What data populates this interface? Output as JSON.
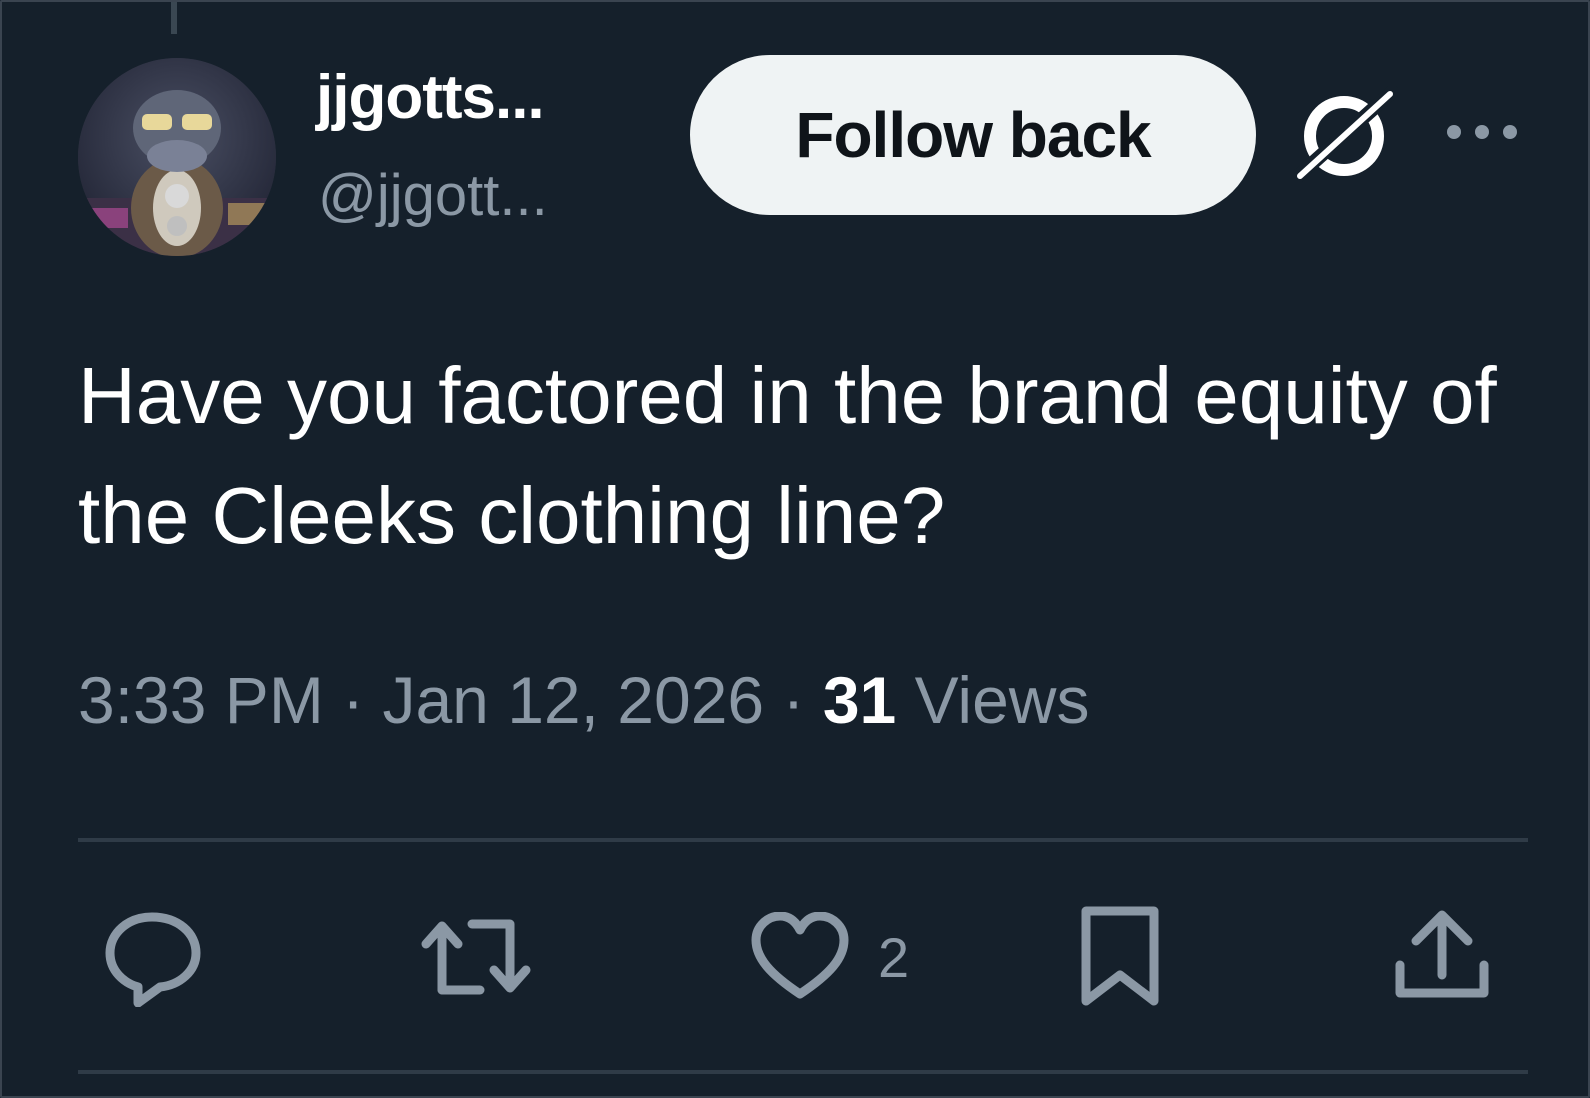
{
  "author": {
    "display_name": "jjgotts...",
    "handle": "@jjgott..."
  },
  "follow_button": {
    "label": "Follow back"
  },
  "tweet": {
    "text": "Have you factored in the brand equity of the Cleeks clothing line?",
    "time": "3:33 PM",
    "separator": "·",
    "date": "Jan 12, 2026",
    "views_count": "31",
    "views_label": "Views"
  },
  "actions": {
    "reply": {
      "icon": "reply-icon"
    },
    "retweet": {
      "icon": "retweet-icon"
    },
    "like": {
      "icon": "heart-icon",
      "count": "2"
    },
    "bookmark": {
      "icon": "bookmark-icon"
    },
    "share": {
      "icon": "share-icon"
    }
  },
  "colors": {
    "background": "#15202b",
    "text_primary": "#ffffff",
    "text_secondary": "#8b98a5",
    "button_bg": "#eff3f4",
    "divider": "#2f3b47"
  }
}
